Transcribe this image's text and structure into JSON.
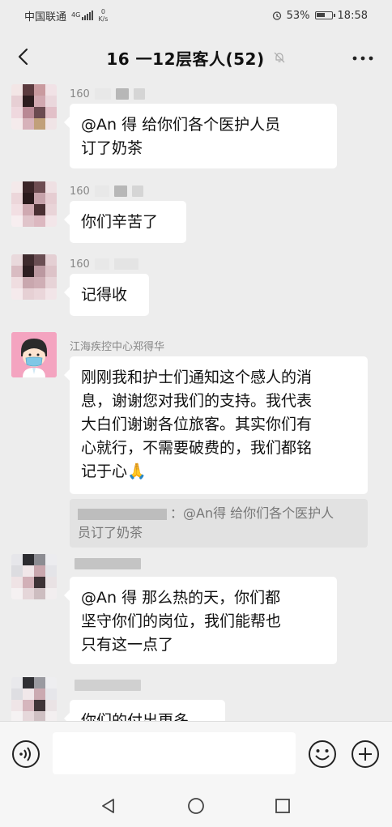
{
  "status_bar": {
    "carrier": "中国联通",
    "network": "4G",
    "speed_value": "0",
    "speed_unit": "K/s",
    "battery": "53%",
    "time": "18:58"
  },
  "header": {
    "title": "16 一12层客人(52)"
  },
  "messages": [
    {
      "sender": "160",
      "text_lines": [
        "@An 得  给你们各个医护人员",
        "订了奶茶"
      ]
    },
    {
      "sender": "160",
      "text_lines": [
        "你们辛苦了"
      ]
    },
    {
      "sender": "160",
      "text_lines": [
        "记得收"
      ]
    },
    {
      "sender": "江海疾控中心郑得华",
      "text_lines": [
        "刚刚我和护士们通知这个感人的消",
        "息，谢谢您对我们的支持。我代表",
        "大白们谢谢各位旅客。其实你们有",
        "心就行，不需要破费的，我们都铭",
        "记于心🙏"
      ],
      "quote": {
        "text_line1": "：@An得 给你们各个医护人",
        "text_line2": "员订了奶茶"
      }
    },
    {
      "sender": "",
      "text_lines": [
        "@An 得  那么热的天，你们都",
        "坚守你们的岗位，我们能帮也",
        "只有这一点了"
      ]
    },
    {
      "sender": "",
      "text_lines": [
        "你们的付出更多"
      ]
    }
  ],
  "input": {
    "placeholder": "",
    "value": ""
  },
  "colors": {
    "background": "#ededed",
    "bubble": "#ffffff",
    "sender": "#888888"
  }
}
